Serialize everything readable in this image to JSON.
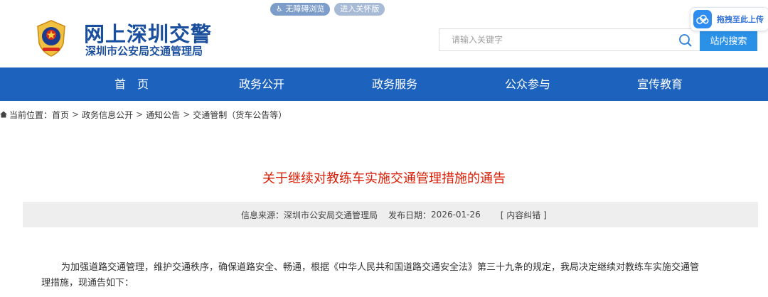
{
  "header": {
    "site_title": "网上深圳交警",
    "site_subtitle": "深圳市公安局交通管理局",
    "top_links": [
      "无障碍浏览",
      "进入关怀版"
    ],
    "search": {
      "placeholder": "请输入关键字",
      "button_label": "站内搜索"
    },
    "float_upload_label": "拖拽至此上传"
  },
  "nav": {
    "items": [
      "首　页",
      "政务公开",
      "政务服务",
      "公众参与",
      "宣传教育"
    ]
  },
  "breadcrumb": {
    "label": "当前位置：",
    "items": [
      "首页",
      "政务信息公开",
      "通知公告",
      "交通管制（货车公告等）"
    ]
  },
  "article": {
    "title": "关于继续对教练车实施交通管理措施的通告",
    "source_label": "信息来源：",
    "source_value": "深圳市公安局交通管理局",
    "date_label": "发布日期：",
    "date_value": "2026-01-26",
    "error_link": "[ 内容纠错 ]",
    "paragraph_line1": "为加强道路交通管理，维护交通秩序，确保道路安全、畅通，根据《中华人民共和国道路交通安全法》第三十九条的规定，我局决定继续对教练车实施交通管",
    "paragraph_line2": "理措施，现通告如下："
  },
  "colors": {
    "brand_blue": "#1d63bd",
    "title_red": "#d81e06",
    "search_button": "#2b91e7"
  }
}
